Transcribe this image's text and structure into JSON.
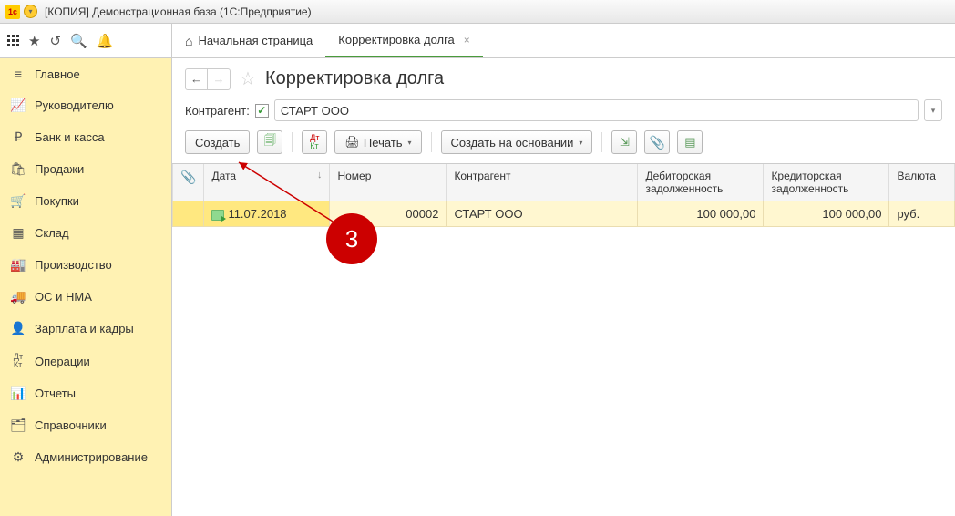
{
  "titlebar": {
    "text": "[КОПИЯ] Демонстрационная база  (1С:Предприятие)"
  },
  "tabs": {
    "home": "Начальная страница",
    "active": "Корректировка долга"
  },
  "sidebar": {
    "items": [
      {
        "label": "Главное"
      },
      {
        "label": "Руководителю"
      },
      {
        "label": "Банк и касса"
      },
      {
        "label": "Продажи"
      },
      {
        "label": "Покупки"
      },
      {
        "label": "Склад"
      },
      {
        "label": "Производство"
      },
      {
        "label": "ОС и НМА"
      },
      {
        "label": "Зарплата и кадры"
      },
      {
        "label": "Операции"
      },
      {
        "label": "Отчеты"
      },
      {
        "label": "Справочники"
      },
      {
        "label": "Администрирование"
      }
    ]
  },
  "page": {
    "title": "Корректировка долга"
  },
  "filter": {
    "label": "Контрагент:",
    "value": "СТАРТ ООО"
  },
  "toolbar": {
    "create": "Создать",
    "print": "Печать",
    "create_based": "Создать на основании",
    "dtkt": "Дт\nКт"
  },
  "table": {
    "headers": {
      "date": "Дата",
      "number": "Номер",
      "contractor": "Контрагент",
      "debit": "Дебиторская задолженность",
      "credit": "Кредиторская задолженность",
      "currency": "Валюта"
    },
    "rows": [
      {
        "date": "11.07.2018",
        "number": "00002",
        "contractor": "СТАРТ ООО",
        "debit": "100 000,00",
        "credit": "100 000,00",
        "currency": "руб."
      }
    ]
  },
  "annotation": {
    "number": "3"
  }
}
